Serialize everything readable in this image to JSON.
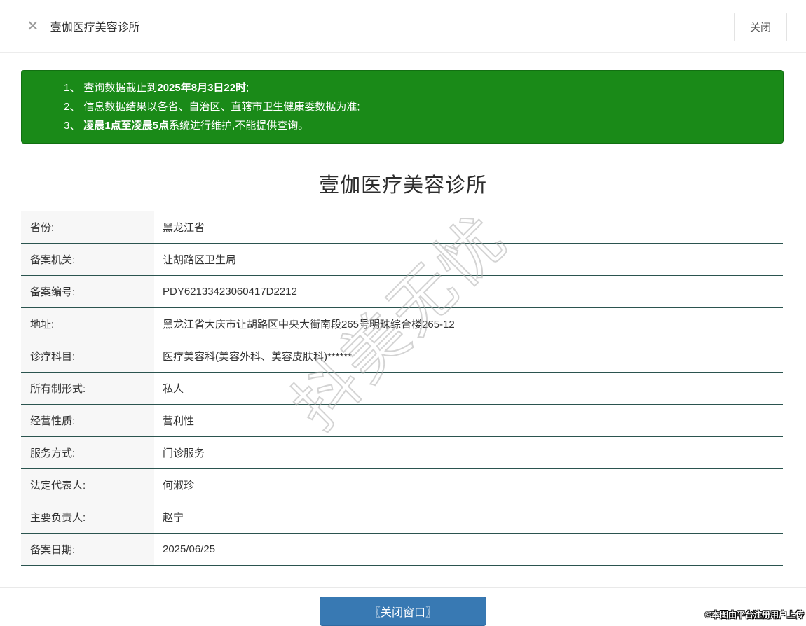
{
  "header": {
    "title": "壹伽医疗美容诊所",
    "close_icon": "✕",
    "close_button_label": "关闭"
  },
  "notice": {
    "items": [
      {
        "num": "1、",
        "pre": "查询数据截止到",
        "bold": "2025年8月3日22时",
        "post": ";"
      },
      {
        "num": "2、",
        "pre": "信息数据结果以各省、自治区、直辖市卫生健康委数据为准;",
        "bold": "",
        "post": ""
      },
      {
        "num": "3、",
        "pre": "",
        "bold": "凌晨1点至凌晨5点",
        "post": "系统进行维护,不能提供查询。"
      }
    ]
  },
  "clinic": {
    "title": "壹伽医疗美容诊所",
    "fields": [
      {
        "label": "省份:",
        "value": "黑龙江省"
      },
      {
        "label": "备案机关:",
        "value": "让胡路区卫生局"
      },
      {
        "label": "备案编号:",
        "value": "PDY62133423060417D2212"
      },
      {
        "label": "地址:",
        "value": "黑龙江省大庆市让胡路区中央大街南段265号明珠综合楼265-12"
      },
      {
        "label": "诊疗科目:",
        "value": "医疗美容科(美容外科、美容皮肤科)******"
      },
      {
        "label": "所有制形式:",
        "value": "私人"
      },
      {
        "label": "经营性质:",
        "value": "营利性"
      },
      {
        "label": "服务方式:",
        "value": "门诊服务"
      },
      {
        "label": "法定代表人:",
        "value": "何淑珍"
      },
      {
        "label": "主要负责人:",
        "value": "赵宁"
      },
      {
        "label": "备案日期:",
        "value": "2025/06/25"
      }
    ]
  },
  "footer": {
    "close_window_button_label": "〖关闭窗口〗"
  },
  "watermarks": {
    "diagonal": "抖美无忧",
    "credit": "©本图由平台注册用户上传"
  },
  "colors": {
    "notice_green": "#1a8a18",
    "button_blue": "#3879b3",
    "row_divider": "#2b544f",
    "label_bg": "#f7f7f7"
  }
}
